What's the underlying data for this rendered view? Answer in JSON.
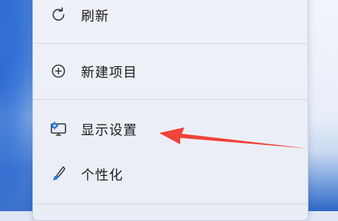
{
  "context_menu": {
    "items": [
      {
        "label": "刷新",
        "icon": "refresh-icon"
      },
      {
        "label": "新建项目",
        "icon": "add-circle-icon"
      },
      {
        "label": "显示设置",
        "icon": "display-settings-icon"
      },
      {
        "label": "个性化",
        "icon": "brush-icon"
      }
    ]
  },
  "annotation": {
    "type": "arrow",
    "color": "#f0433a",
    "points_to": "显示设置"
  },
  "colors": {
    "menu_background": "#eceff7",
    "menu_border": "#c9d0dd",
    "icon_blue": "#2a78d6",
    "text": "#1c1c1c"
  }
}
